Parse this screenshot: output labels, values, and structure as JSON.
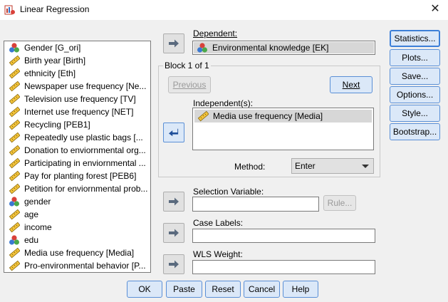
{
  "window": {
    "title": "Linear Regression"
  },
  "variables": [
    {
      "label": "Gender [G_ori]",
      "icon": "nominal-icon"
    },
    {
      "label": "Birth year [Birth]",
      "icon": "scale-ruler-icon"
    },
    {
      "label": "ethnicity [Eth]",
      "icon": "scale-ruler-icon"
    },
    {
      "label": "Newspaper use frequency [Ne...",
      "icon": "scale-ruler-icon"
    },
    {
      "label": "Television use frequency [TV]",
      "icon": "scale-ruler-icon"
    },
    {
      "label": "Internet use frequency [NET]",
      "icon": "scale-ruler-icon"
    },
    {
      "label": "Recycling [PEB1]",
      "icon": "scale-ruler-icon"
    },
    {
      "label": "Repeatedly use plastic bags [...",
      "icon": "scale-ruler-icon"
    },
    {
      "label": "Donation to enviornmental org...",
      "icon": "scale-ruler-icon"
    },
    {
      "label": "Participating in enviornmental ...",
      "icon": "scale-ruler-icon"
    },
    {
      "label": "Pay for planting forest [PEB6]",
      "icon": "scale-ruler-icon"
    },
    {
      "label": "Petition for enviornmental prob...",
      "icon": "scale-ruler-icon"
    },
    {
      "label": "gender",
      "icon": "nominal-icon"
    },
    {
      "label": "age",
      "icon": "scale-ruler-icon"
    },
    {
      "label": "income",
      "icon": "scale-ruler-icon"
    },
    {
      "label": "edu",
      "icon": "nominal-icon"
    },
    {
      "label": "Media use frequency [Media]",
      "icon": "scale-ruler-icon"
    },
    {
      "label": "Pro-environmental behavior [P...",
      "icon": "scale-ruler-icon"
    }
  ],
  "dependent": {
    "label": "Dependent:",
    "value": "Environmental knowledge [EK]"
  },
  "block": {
    "title": "Block 1 of 1",
    "previous": "Previous",
    "next": "Next",
    "independents_label": "Independent(s):",
    "independents": [
      "Media use frequency [Media]"
    ],
    "method_label": "Method:",
    "method_value": "Enter"
  },
  "selection": {
    "label": "Selection Variable:",
    "rule": "Rule..."
  },
  "case_labels": {
    "label": "Case Labels:"
  },
  "wls": {
    "label": "WLS Weight:"
  },
  "side_buttons": [
    "Statistics...",
    "Plots...",
    "Save...",
    "Options...",
    "Style...",
    "Bootstrap..."
  ],
  "bottom_buttons": [
    "OK",
    "Paste",
    "Reset",
    "Cancel",
    "Help"
  ],
  "colors": {
    "accent": "#3c7fd8",
    "selection_bg": "#d7d7d7"
  }
}
